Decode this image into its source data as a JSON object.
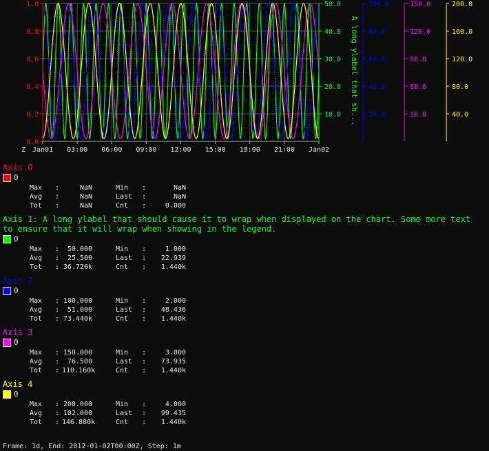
{
  "chart_data": {
    "type": "line",
    "x_tick_labels": [
      "Jan01",
      "03:00",
      "06:00",
      "09:00",
      "12:00",
      "15:00",
      "18:00",
      "21:00",
      "Jan02"
    ],
    "timezone_label": "Z",
    "grid": true,
    "axes": [
      {
        "id": 0,
        "color": "#ff0000",
        "ylim": [
          0,
          1
        ],
        "tick_labels": [
          "0.0",
          "0.2",
          "0.4",
          "0.6",
          "0.8",
          "1.0"
        ],
        "side": "left",
        "ylabel": ""
      },
      {
        "id": 1,
        "color": "#00ff00",
        "ylim": [
          0,
          50
        ],
        "tick_labels": [
          "10.0",
          "20.0",
          "30.0",
          "40.0",
          "50.0"
        ],
        "side": "right",
        "ylabel": "A long ylabel that sh..."
      },
      {
        "id": 2,
        "color": "#0000ff",
        "ylim": [
          0,
          100
        ],
        "tick_labels": [
          "20.0",
          "40.0",
          "60.0",
          "80.0",
          "100.0"
        ],
        "side": "right",
        "ylabel": ""
      },
      {
        "id": 3,
        "color": "#ff00ff",
        "ylim": [
          0,
          150
        ],
        "tick_labels": [
          "30.0",
          "60.0",
          "90.0",
          "120.0",
          "150.0"
        ],
        "side": "right",
        "ylabel": ""
      },
      {
        "id": 4,
        "color": "#ffff00",
        "ylim": [
          0,
          200
        ],
        "tick_labels": [
          "40.0",
          "80.0",
          "120.0",
          "160.0",
          "200.0"
        ],
        "side": "right",
        "ylabel": ""
      }
    ],
    "series": [
      {
        "name": "0",
        "axis": 1,
        "color": "#00ff00",
        "min": 1,
        "max": 50,
        "cycles": 22,
        "phase": 0.0
      },
      {
        "name": "0",
        "axis": 2,
        "color": "#0000ff",
        "min": 2,
        "max": 100,
        "cycles": 11,
        "phase": 0.25
      },
      {
        "name": "0",
        "axis": 3,
        "color": "#ff00ff",
        "min": 3,
        "max": 150,
        "cycles": 8,
        "phase": 0.5
      },
      {
        "name": "0",
        "axis": 4,
        "color": "#ffff00",
        "min": 4,
        "max": 200,
        "cycles": 9,
        "phase": 0.75
      }
    ]
  },
  "legend": [
    {
      "title": "Axis 0",
      "color": "#ff0000",
      "series_name": "0",
      "stats": {
        "max": "NaN",
        "min": "NaN",
        "avg": "NaN",
        "last": "NaN",
        "tot": "NaN",
        "cnt": "0.000"
      }
    },
    {
      "title": "Axis 1: A long ylabel that should cause it to wrap when displayed on the chart. Some more text to ensure that it will wrap when showing in the legend.",
      "color": "#00ff00",
      "series_name": "0",
      "stats": {
        "max": "50.000",
        "min": "1.000",
        "avg": "25.500",
        "last": "22.939",
        "tot": "36.720k",
        "cnt": "1.440k"
      }
    },
    {
      "title": "Axis 2",
      "color": "#0000ff",
      "series_name": "0",
      "stats": {
        "max": "100.000",
        "min": "2.000",
        "avg": "51.000",
        "last": "48.436",
        "tot": "73.440k",
        "cnt": "1.440k"
      }
    },
    {
      "title": "Axis 3",
      "color": "#ff00ff",
      "series_name": "0",
      "stats": {
        "max": "150.000",
        "min": "3.000",
        "avg": "76.500",
        "last": "73.935",
        "tot": "110.160k",
        "cnt": "1.440k"
      }
    },
    {
      "title": "Axis 4",
      "color": "#ffff00",
      "series_name": "0",
      "stats": {
        "max": "200.000",
        "min": "4.000",
        "avg": "102.000",
        "last": "99.435",
        "tot": "146.880k",
        "cnt": "1.440k"
      }
    }
  ],
  "stat_labels": {
    "max": "Max",
    "min": "Min",
    "avg": "Avg",
    "last": "Last",
    "tot": "Tot",
    "cnt": "Cnt"
  },
  "footer": "Frame: 1d, End: 2012-01-02T00:00Z, Step: 1m"
}
